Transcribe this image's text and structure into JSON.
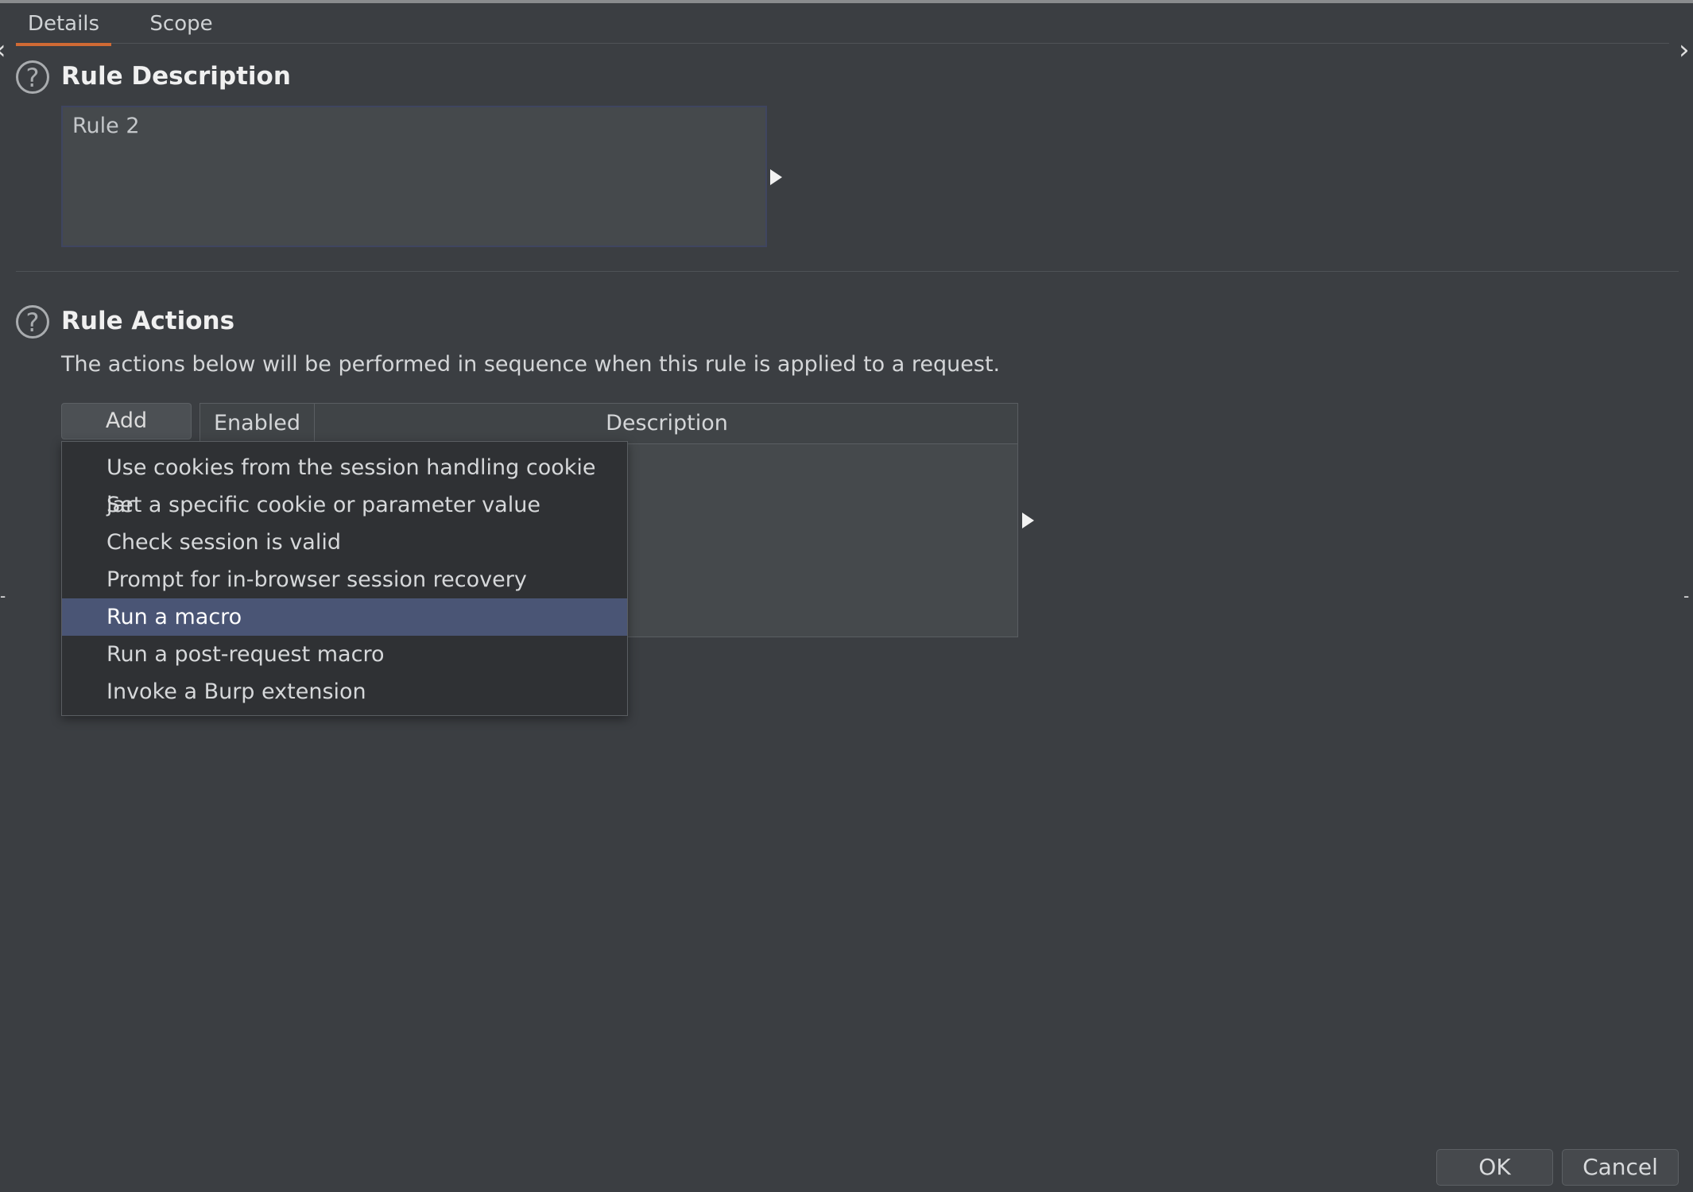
{
  "tabs": [
    {
      "label": "Details",
      "active": true
    },
    {
      "label": "Scope",
      "active": false
    }
  ],
  "rule_description": {
    "title": "Rule Description",
    "value": "Rule 2"
  },
  "rule_actions": {
    "title": "Rule Actions",
    "info": "The actions below will be performed in sequence when this rule is applied to a request.",
    "add_label": "Add",
    "columns": [
      "Enabled",
      "Description"
    ]
  },
  "add_menu": {
    "items": [
      "Use cookies from the session handling cookie jar",
      "Set a specific cookie or parameter value",
      "Check session is valid",
      "Prompt for in-browser session recovery",
      "Run a macro",
      "Run a post-request macro",
      "Invoke a Burp extension"
    ],
    "selected": "Run a macro"
  },
  "footer": {
    "ok_label": "OK",
    "cancel_label": "Cancel"
  },
  "icons": {
    "help": "help-circle-icon",
    "expand": "play-arrow-icon"
  },
  "colors": {
    "background": "#3b3e42",
    "tab_accent": "#d06a34",
    "selection": "#4a5575"
  }
}
